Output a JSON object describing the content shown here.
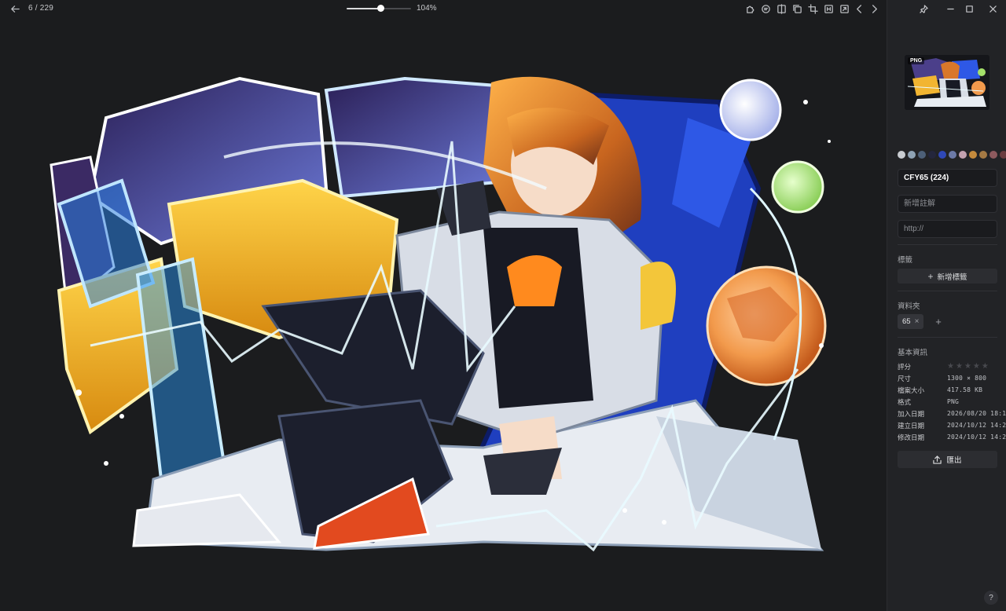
{
  "toolbar": {
    "counter": "6 / 229",
    "zoom_label": "104%",
    "zoom_value": 0.52
  },
  "icons": {
    "back": "arrow-left-icon",
    "toolbar_right": [
      "puzzle-icon",
      "comment-icon",
      "compare-icon",
      "copy-icon",
      "crop-icon",
      "ocr-icon",
      "fit-icon",
      "chevron-left-icon",
      "chevron-right-icon"
    ],
    "window": [
      "pin-icon",
      "minimize-icon",
      "maximize-icon",
      "close-icon"
    ]
  },
  "inspector": {
    "format_badge": "PNG",
    "palette": [
      "#c9cdd2",
      "#8fa3b5",
      "#4d6078",
      "#24263c",
      "#2f48b8",
      "#6c7aa8",
      "#c3a2b0",
      "#c48a3c",
      "#a57a44",
      "#8d5a5e",
      "#6a3c40"
    ],
    "name_value": "CFY65 (224)",
    "note_placeholder": "新增註解",
    "url_placeholder": "http://",
    "tags_label": "標籤",
    "add_tag_label": "新增標籤",
    "folders_label": "資料夾",
    "folder_chip": "65",
    "basic_info_label": "基本資訊",
    "info": {
      "rating_label": "評分",
      "rating": 0,
      "rating_max": 5,
      "size_label": "尺寸",
      "size_value": "1300 × 800",
      "filesize_label": "檔案大小",
      "filesize_value": "417.58 KB",
      "format_label": "格式",
      "format_value": "PNG",
      "added_label": "加入日期",
      "added_value": "2026/08/20 18:1",
      "created_label": "建立日期",
      "created_value": "2024/10/12 14:2",
      "modified_label": "修改日期",
      "modified_value": "2024/10/12 14:2"
    },
    "export_label": "匯出",
    "help_label": "?"
  }
}
